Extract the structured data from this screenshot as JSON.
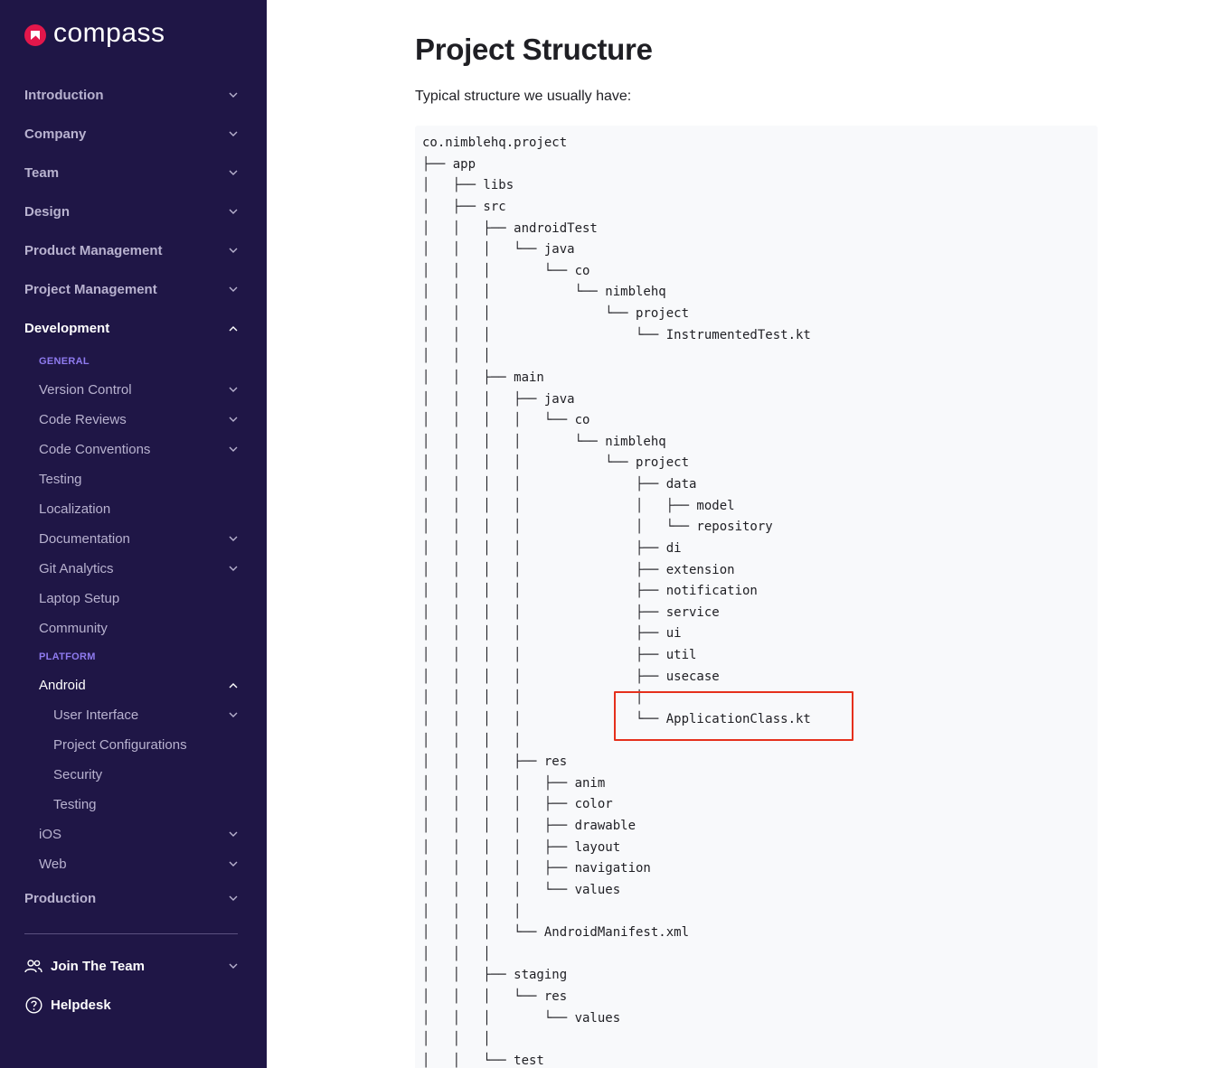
{
  "app": {
    "logo_text": "compass",
    "brand_color": "#e3174b",
    "sidebar_bg": "#1f1646",
    "accent_color": "#8f7bf0",
    "highlight_color": "#e5301c"
  },
  "sidebar": {
    "top_items": [
      {
        "label": "Introduction",
        "icon": "chevron-down-icon"
      },
      {
        "label": "Company",
        "icon": "chevron-down-icon"
      },
      {
        "label": "Team",
        "icon": "chevron-down-icon"
      },
      {
        "label": "Design",
        "icon": "chevron-down-icon"
      },
      {
        "label": "Product Management",
        "icon": "chevron-down-icon"
      },
      {
        "label": "Project Management",
        "icon": "chevron-down-icon"
      },
      {
        "label": "Development",
        "icon": "chevron-up-icon",
        "expanded": true
      }
    ],
    "general_label": "GENERAL",
    "general_items": [
      {
        "label": "Version Control",
        "has_children": true
      },
      {
        "label": "Code Reviews",
        "has_children": true
      },
      {
        "label": "Code Conventions",
        "has_children": true
      },
      {
        "label": "Testing",
        "has_children": false
      },
      {
        "label": "Localization",
        "has_children": false
      },
      {
        "label": "Documentation",
        "has_children": true
      },
      {
        "label": "Git Analytics",
        "has_children": true
      },
      {
        "label": "Laptop Setup",
        "has_children": false
      },
      {
        "label": "Community",
        "has_children": false
      }
    ],
    "platform_label": "PLATFORM",
    "android": {
      "label": "Android",
      "expanded": true
    },
    "android_items": [
      {
        "label": "User Interface",
        "has_children": true
      },
      {
        "label": "Project Configurations",
        "has_children": false
      },
      {
        "label": "Security",
        "has_children": false
      },
      {
        "label": "Testing",
        "has_children": false
      }
    ],
    "platform_more": [
      {
        "label": "iOS",
        "has_children": true
      },
      {
        "label": "Web",
        "has_children": true
      }
    ],
    "production": {
      "label": "Production"
    },
    "footer": [
      {
        "label": "Join The Team",
        "icon": "people-icon",
        "has_children": true
      },
      {
        "label": "Helpdesk",
        "icon": "question-circle-icon",
        "has_children": false
      }
    ]
  },
  "main": {
    "title": "Project Structure",
    "intro": "Typical structure we usually have:",
    "code_lines": [
      "co.nimblehq.project",
      "├── app",
      "│   ├── libs",
      "│   ├── src",
      "│   │   ├── androidTest",
      "│   │   │   └── java",
      "│   │   │       └── co",
      "│   │   │           └── nimblehq",
      "│   │   │               └── project",
      "│   │   │                   └── InstrumentedTest.kt",
      "│   │   │",
      "│   │   ├── main",
      "│   │   │   ├── java",
      "│   │   │   │   └── co",
      "│   │   │   │       └── nimblehq",
      "│   │   │   │           └── project",
      "│   │   │   │               ├── data",
      "│   │   │   │               │   ├── model",
      "│   │   │   │               │   └── repository",
      "│   │   │   │               ├── di",
      "│   │   │   │               ├── extension",
      "│   │   │   │               ├── notification",
      "│   │   │   │               ├── service",
      "│   │   │   │               ├── ui",
      "│   │   │   │               ├── util",
      "│   │   │   │               ├── usecase",
      "│   │   │   │               │",
      "│   │   │   │               └── ApplicationClass.kt",
      "│   │   │   │",
      "│   │   │   ├── res",
      "│   │   │   │   ├── anim",
      "│   │   │   │   ├── color",
      "│   │   │   │   ├── drawable",
      "│   │   │   │   ├── layout",
      "│   │   │   │   ├── navigation",
      "│   │   │   │   └── values",
      "│   │   │   │",
      "│   │   │   └── AndroidManifest.xml",
      "│   │   │",
      "│   │   ├── staging",
      "│   │   │   └── res",
      "│   │   │       └── values",
      "│   │   │",
      "│   │   └── test"
    ]
  }
}
